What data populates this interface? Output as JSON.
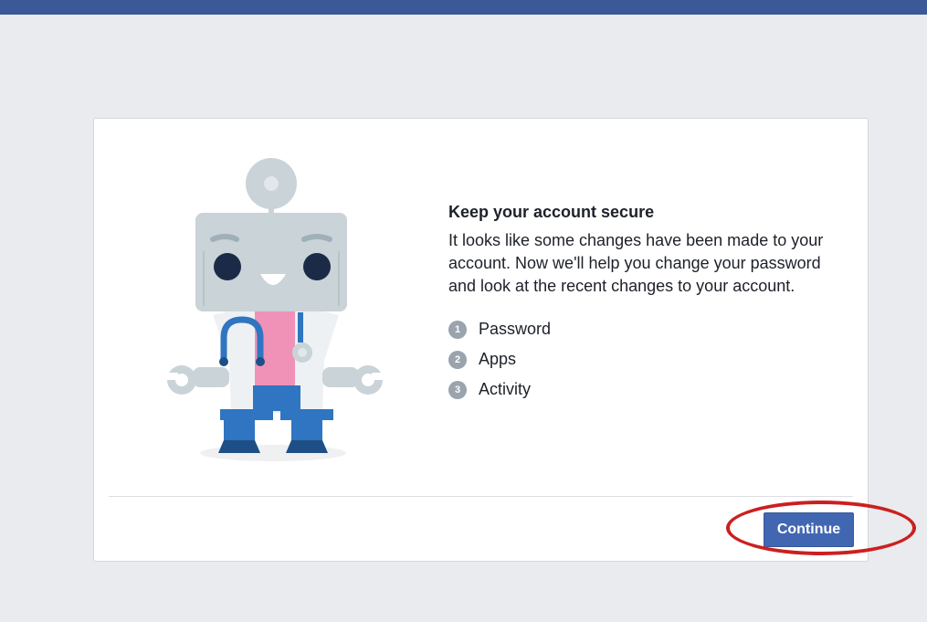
{
  "colors": {
    "brand": "#3b5998",
    "button": "#4267b2",
    "annotation": "#cc1f1f",
    "background": "#e9ebee"
  },
  "card": {
    "title": "Keep your account secure",
    "description": "It looks like some changes have been made to your account. Now we'll help you change your password and look at the recent changes to your account.",
    "illustration_icon": "doctor-robot-illustration",
    "steps": [
      {
        "num": "1",
        "label": "Password"
      },
      {
        "num": "2",
        "label": "Apps"
      },
      {
        "num": "3",
        "label": "Activity"
      }
    ],
    "continue_label": "Continue"
  }
}
